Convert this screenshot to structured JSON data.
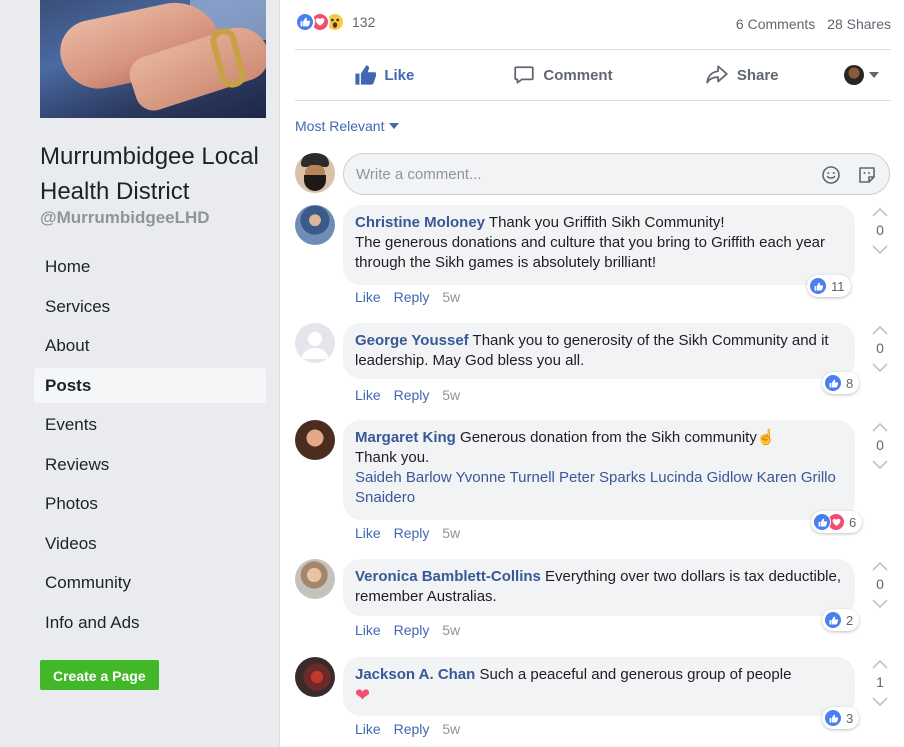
{
  "page": {
    "name": "Murrumbidgee Local Health District",
    "handle": "@MurrumbidgeeLHD"
  },
  "nav": {
    "items": [
      {
        "label": "Home"
      },
      {
        "label": "Services"
      },
      {
        "label": "About"
      },
      {
        "label": "Posts",
        "active": true
      },
      {
        "label": "Events"
      },
      {
        "label": "Reviews"
      },
      {
        "label": "Photos"
      },
      {
        "label": "Videos"
      },
      {
        "label": "Community"
      },
      {
        "label": "Info and Ads"
      }
    ],
    "create_page": "Create a Page"
  },
  "post": {
    "reaction_count": "132",
    "reaction_types": [
      "like-icon",
      "love-icon",
      "wow-icon"
    ],
    "comments_count": "6 Comments",
    "shares_count": "28 Shares",
    "actions": {
      "like": "Like",
      "comment": "Comment",
      "share": "Share"
    },
    "sort_label": "Most Relevant",
    "composer_placeholder": "Write a comment..."
  },
  "comments": [
    {
      "author": "Christine Moloney",
      "text": "Thank you Griffith Sikh Community! The generous donations and culture that you bring to Griffith each year through the Sikh games is absolutely brilliant!",
      "line1": " Thank you Griffith Sikh Community!",
      "line2": "The generous donations and culture that you bring to Griffith each year through the Sikh games is absolutely brilliant!",
      "reactions": "11",
      "score": "0",
      "like": "Like",
      "reply": "Reply",
      "time": "5w"
    },
    {
      "author": "George Youssef",
      "text": " Thank you to generosity of the Sikh Community and it leadership. May God bless you all.",
      "reactions": "8",
      "score": "0",
      "like": "Like",
      "reply": "Reply",
      "time": "5w"
    },
    {
      "author": "Margaret King",
      "text": " Generous donation from the Sikh community",
      "line2": "Thank you.",
      "mentions": "Saideh Barlow Yvonne Turnell Peter Sparks Lucinda Gidlow Karen Grillo Snaidero",
      "reactions": "6",
      "score": "0",
      "like": "Like",
      "reply": "Reply",
      "time": "5w"
    },
    {
      "author": "Veronica Bamblett-Collins",
      "text": " Everything over two dollars is tax deductible, remember Australias.",
      "reactions": "2",
      "score": "0",
      "like": "Like",
      "reply": "Reply",
      "time": "5w"
    },
    {
      "author": "Jackson A. Chan",
      "text": " Such a peaceful and generous group of people",
      "reactions": "3",
      "score": "1",
      "like": "Like",
      "reply": "Reply",
      "time": "5w"
    }
  ],
  "colors": {
    "link": "#385898",
    "like_blue": "#4267b2",
    "create_green": "#42b72a",
    "sidebar_bg": "#e9ebee"
  }
}
